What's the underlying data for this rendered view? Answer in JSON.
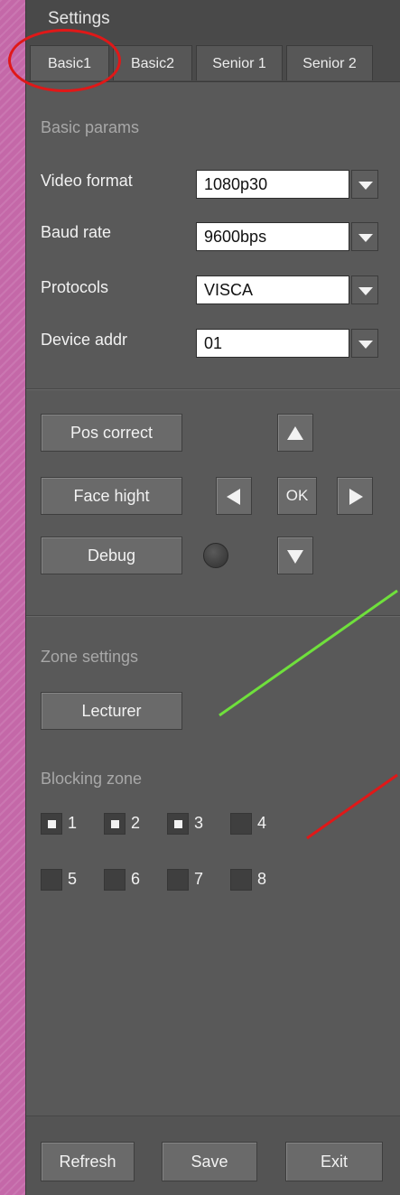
{
  "window": {
    "title": "Settings"
  },
  "tabs": [
    {
      "label": "Basic1",
      "active": true
    },
    {
      "label": "Basic2",
      "active": false
    },
    {
      "label": "Senior 1",
      "active": false
    },
    {
      "label": "Senior 2",
      "active": false
    }
  ],
  "basic": {
    "heading": "Basic params",
    "fields": [
      {
        "label": "Video format",
        "value": "1080p30"
      },
      {
        "label": "Baud rate",
        "value": "9600bps"
      },
      {
        "label": "Protocols",
        "value": "VISCA"
      },
      {
        "label": "Device addr",
        "value": "01"
      }
    ]
  },
  "controls": {
    "pos_correct": "Pos correct",
    "face_hight": "Face hight",
    "debug": "Debug",
    "ok": "OK",
    "led_color": "#3a3a3a"
  },
  "zone": {
    "heading": "Zone settings",
    "lecturer": "Lecturer"
  },
  "blocking": {
    "heading": "Blocking zone",
    "items": [
      {
        "label": "1",
        "checked": true
      },
      {
        "label": "2",
        "checked": true
      },
      {
        "label": "3",
        "checked": true
      },
      {
        "label": "4",
        "checked": false
      },
      {
        "label": "5",
        "checked": false
      },
      {
        "label": "6",
        "checked": false
      },
      {
        "label": "7",
        "checked": false
      },
      {
        "label": "8",
        "checked": false
      }
    ]
  },
  "footer": {
    "refresh": "Refresh",
    "save": "Save",
    "exit": "Exit"
  },
  "annotations": {
    "ring_color": "#e01818",
    "green_line_color": "#6fe03c",
    "red_line_color": "#e01818"
  }
}
